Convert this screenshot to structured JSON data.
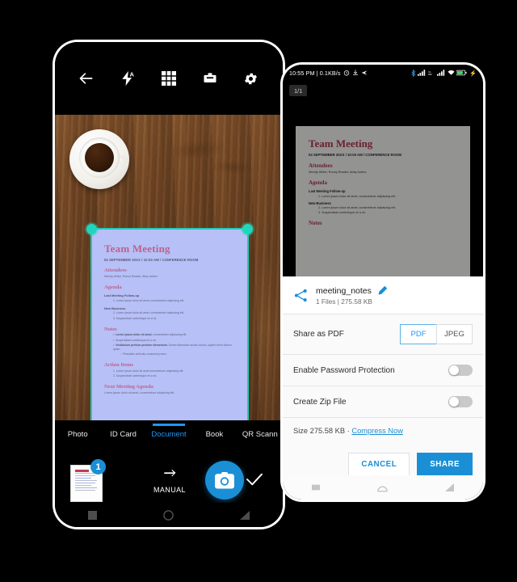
{
  "colors": {
    "accent": "#1a8fd6",
    "tab_active": "#2196f3",
    "crop_handle": "#1fd6bd",
    "doc_heading": "#c13b5a"
  },
  "left_phone": {
    "toolbar": [
      {
        "name": "back-arrow-icon",
        "label": "Back"
      },
      {
        "name": "flash-auto-icon",
        "label": "Flash auto"
      },
      {
        "name": "grid-icon",
        "label": "Grid"
      },
      {
        "name": "filter-icon",
        "label": "Filter"
      },
      {
        "name": "gear-icon",
        "label": "Settings"
      }
    ],
    "modes": [
      {
        "label": "Photo",
        "active": false
      },
      {
        "label": "ID Card",
        "active": false
      },
      {
        "label": "Document",
        "active": true
      },
      {
        "label": "Book",
        "active": false
      },
      {
        "label": "QR Scann",
        "active": false
      }
    ],
    "thumbnail_badge": "1",
    "manual_label": "MANUAL",
    "shutter_label": "Capture",
    "confirm_label": "Done"
  },
  "document": {
    "title": "Team Meeting",
    "subtitle": "04 SEPTEMBER 20XX / 10:00 AM / CONFERENCE ROOM",
    "sections": {
      "attendees_heading": "Attendees",
      "attendees_body": "Wendy Writer, Ronny Reader, Abby Author",
      "agenda_heading": "Agenda",
      "followup_heading": "Last Meeting Follow-up",
      "followup_item1": "1.  Lorem ipsum dolor sit amet, consectetuer adipiscing elit.",
      "newbusiness_heading": "New Business",
      "newbusiness_item1": "2.  Lorem ipsum dolor sit amet, consectetuer adipiscing elit.",
      "newbusiness_item2": "3.  Suspendisse scelerisque mi a mi.",
      "notes_heading": "Notes",
      "notes_item1_bold": "Lorem ipsum dolor sit amet,",
      "notes_item1_rest": " consectetuer adipiscing elit.",
      "notes_item2": "Suspendisse scelerisque mi a mi.",
      "notes_item3_bold": "Vestibulum pretium pretium elementum.",
      "notes_item3_rest": " Donec bibendum auctor cursus, sapien enim dictum quam.",
      "notes_item4": "Phasellus vehicula consummy nunc.",
      "action_heading": "Action Items",
      "action_item1": "1.  Lorem ipsum dolor sit amet consectetuer adipiscing elit.",
      "action_item2": "2.  Suspendisse scelerisque mi a mi.",
      "next_heading": "Next Meeting Agenda",
      "next_body": "Lorem ipsum dolor sit amet, consectetuer adipiscing elit."
    }
  },
  "right_phone": {
    "statusbar": {
      "text": "10:55 PM | 0.1KB/s",
      "left_icons": [
        "alarm-icon",
        "download-icon",
        "send-icon"
      ],
      "right_icons": [
        "bluetooth-icon",
        "signal-bars-icon",
        "vowifi-icon",
        "signal-bars2-icon",
        "wifi-icon",
        "battery-icon"
      ]
    },
    "page_indicator": "1/1",
    "share_sheet": {
      "file_name": "meeting_notes",
      "file_meta": "1 Files | 275.58 KB",
      "share_as_label": "Share as  PDF",
      "format_options": [
        {
          "label": "PDF",
          "selected": true
        },
        {
          "label": "JPEG",
          "selected": false
        }
      ],
      "password_label": "Enable Password Protection",
      "password_on": false,
      "zip_label": "Create Zip File",
      "zip_on": false,
      "size_text": "Size 275.58 KB  · ",
      "compress_link": "Compress Now",
      "cancel_label": "CANCEL",
      "share_label": "SHARE"
    }
  }
}
